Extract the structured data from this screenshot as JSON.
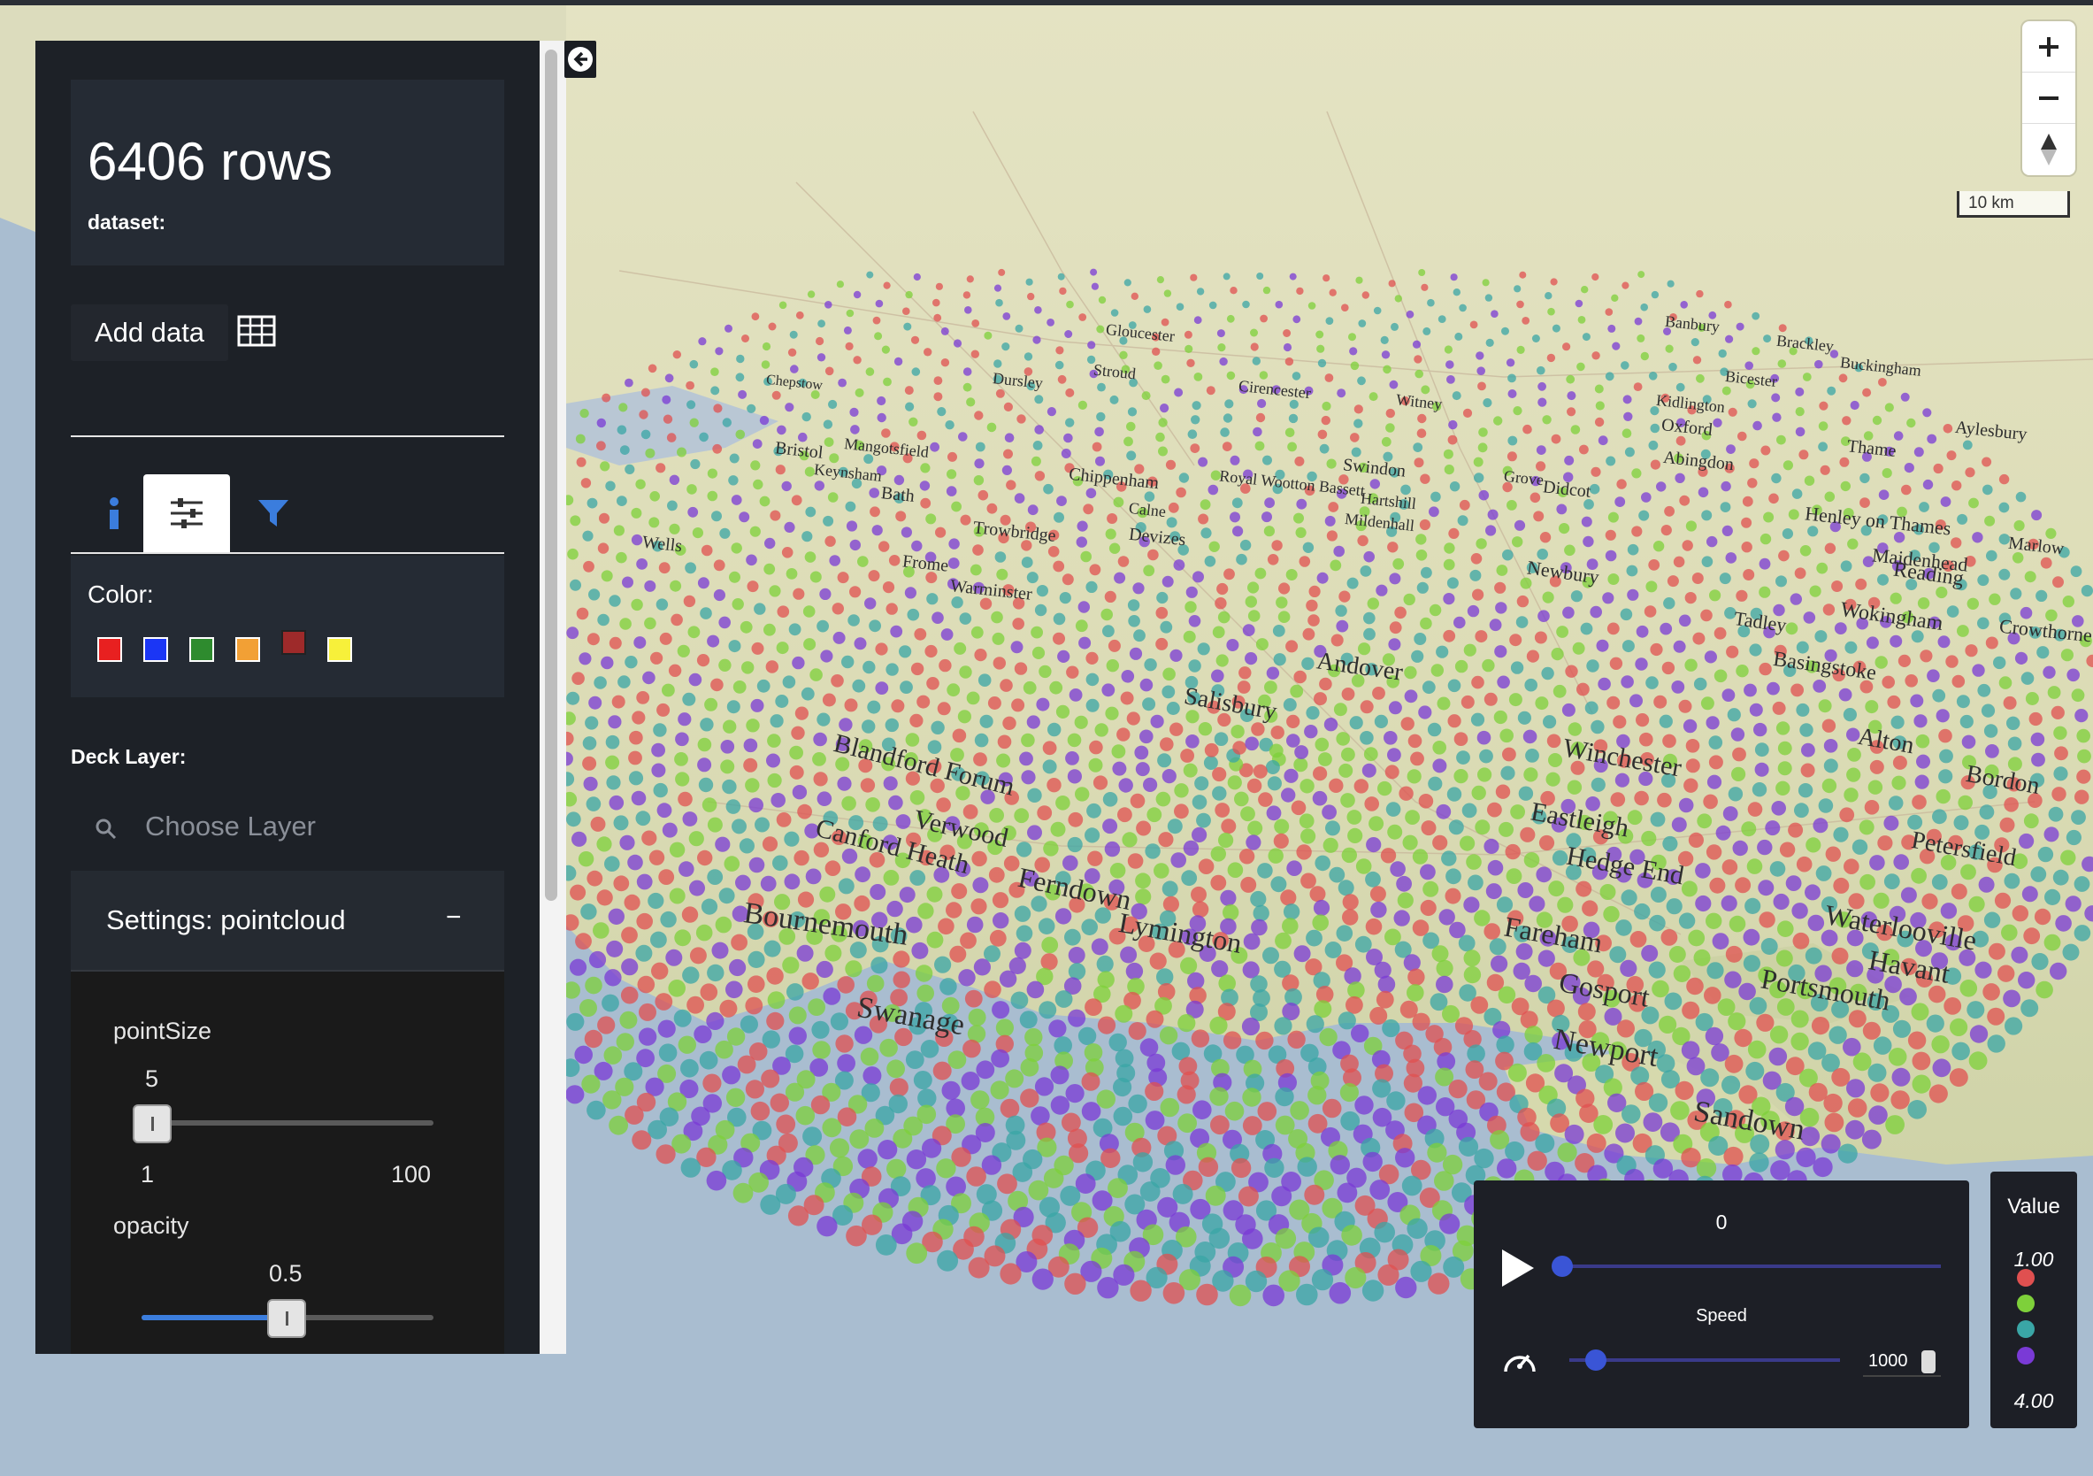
{
  "stats": {
    "title": "6406 rows",
    "dataset_label": "dataset:"
  },
  "toolbar": {
    "add_data_label": "Add data"
  },
  "color": {
    "label": "Color:",
    "swatches": [
      "#e82020",
      "#1b36f5",
      "#2e8b2e",
      "#f2a035",
      "#9e2a2a",
      "#f7f03a"
    ]
  },
  "deck": {
    "label": "Deck Layer:",
    "placeholder": "Choose Layer",
    "settings_title": "Settings: pointcloud",
    "collapse_symbol": "−"
  },
  "point_size": {
    "label": "pointSize",
    "value": "5",
    "min": "1",
    "max": "100"
  },
  "opacity": {
    "label": "opacity",
    "value": "0.5"
  },
  "player": {
    "value": "0",
    "speed_label": "Speed",
    "speed_value": "1000"
  },
  "legend": {
    "title": "Value",
    "max": "1.00",
    "min": "4.00",
    "colors": [
      "#e05050",
      "#7ed03a",
      "#3aa6a6",
      "#7a3ad6"
    ]
  },
  "map": {
    "scale": "10 km",
    "places": [
      "Bournemouth",
      "Swanage",
      "Lymington",
      "Ferndown",
      "Verwood",
      "Blandford Forum",
      "Canford Heath",
      "Salisbury",
      "Andover",
      "Winchester",
      "Eastleigh",
      "Hedge End",
      "Fareham",
      "Gosport",
      "Portsmouth",
      "Havant",
      "Waterlooville",
      "Petersfield",
      "Alton",
      "Bordon",
      "Newport",
      "Sandown",
      "Basingstoke",
      "Wokingham",
      "Reading",
      "Newbury",
      "Tadley",
      "Abingdon",
      "Didcot",
      "Oxford",
      "Swindon",
      "Chippenham",
      "Devizes",
      "Trowbridge",
      "Frome",
      "Warminster",
      "Wells",
      "Bristol",
      "Keynsham",
      "Bath",
      "Mangotsfield",
      "Witney",
      "Cirencester",
      "Stroud",
      "Dursley",
      "Gloucester",
      "Banbury",
      "Bicester",
      "Aylesbury",
      "Thame",
      "Henley on Thames",
      "Maidenhead",
      "Marlow",
      "Crowthorne",
      "Kidlington",
      "Brackley",
      "Buckingham",
      "Royal Wootton Bassett",
      "Calne",
      "Grove",
      "Hartshill",
      "Mildenhall",
      "Chepstow"
    ]
  }
}
